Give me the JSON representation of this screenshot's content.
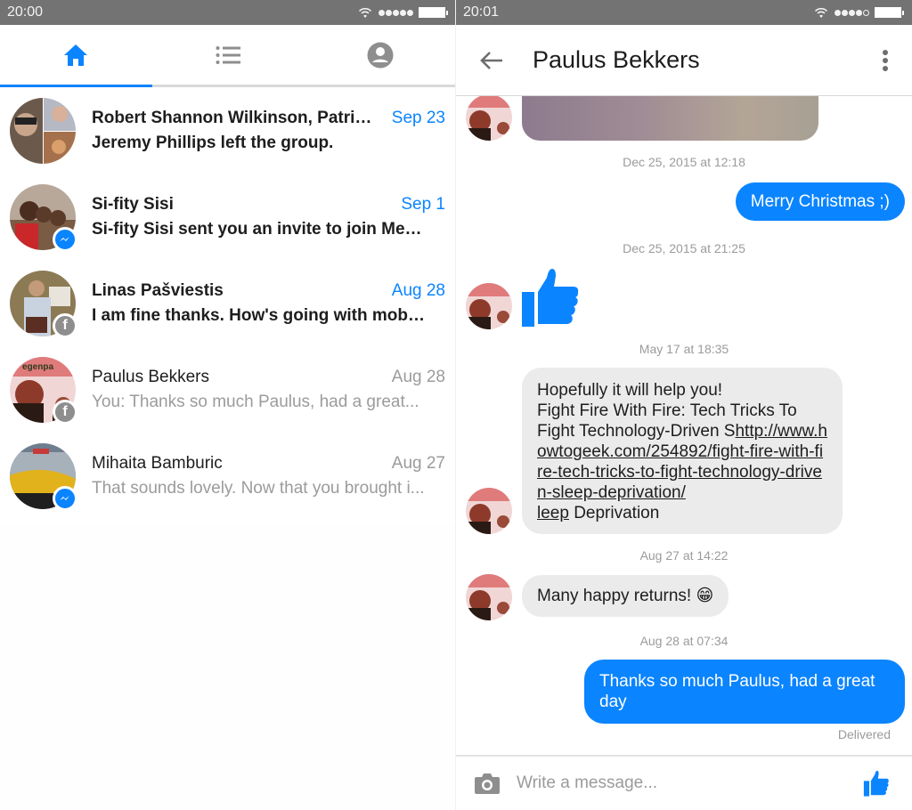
{
  "colors": {
    "accent": "#0a84ff",
    "status_bar": "#737373",
    "incoming_bubble": "#ebebeb",
    "muted_text": "#9b9b9b"
  },
  "left_screen": {
    "status_bar": {
      "time": "20:00",
      "signal_bars_filled": 5,
      "signal_bars_total": 5
    },
    "tabs": [
      {
        "name": "home",
        "icon": "home-icon",
        "active": true
      },
      {
        "name": "list",
        "icon": "list-icon",
        "active": false
      },
      {
        "name": "profile",
        "icon": "person-circle-icon",
        "active": false
      }
    ],
    "conversations": [
      {
        "name": "Robert Shannon Wilkinson, Patrick...",
        "date": "Sep 23",
        "snippet": "Jeremy Phillips left the group.",
        "unread": true,
        "badge": "none",
        "avatar": "group-photo"
      },
      {
        "name": "Si-fity Sisi",
        "date": "Sep 1",
        "snippet": "Si-fity Sisi sent you an invite to join Mess...",
        "unread": true,
        "badge": "messenger",
        "avatar": "group-selfie"
      },
      {
        "name": "Linas Pašviestis",
        "date": "Aug 28",
        "snippet": "I am fine thanks. How's going with mobile...",
        "unread": true,
        "badge": "facebook",
        "avatar": "man-standing"
      },
      {
        "name": "Paulus Bekkers",
        "date": "Aug 28",
        "snippet": "You: Thanks so much Paulus, had a great...",
        "unread": false,
        "badge": "facebook",
        "avatar": "two-men-poster"
      },
      {
        "name": "Mihaita Bamburic",
        "date": "Aug 27",
        "snippet": "That sounds lovely. Now that you brought i...",
        "unread": false,
        "badge": "messenger",
        "avatar": "yellow-helmet"
      }
    ]
  },
  "right_screen": {
    "status_bar": {
      "time": "20:01",
      "signal_bars_filled": 4,
      "signal_bars_total": 5
    },
    "header": {
      "title": "Paulus Bekkers"
    },
    "messages": [
      {
        "type": "image",
        "direction": "in"
      },
      {
        "type": "timestamp",
        "text": "Dec 25, 2015 at 12:18"
      },
      {
        "type": "text",
        "direction": "out",
        "text": "Merry Christmas ;)"
      },
      {
        "type": "timestamp",
        "text": "Dec 25, 2015 at 21:25"
      },
      {
        "type": "like",
        "direction": "in"
      },
      {
        "type": "timestamp",
        "text": "May 17 at 18:35"
      },
      {
        "type": "text",
        "direction": "in",
        "line1": "Hopefully it will help you!",
        "line2": "Fight Fire With Fire: Tech Tricks To Fight Technology-Driven S",
        "link": "http://www.howtogeek.com/254892/fight-fire-with-fire-tech-tricks-to-fight-technology-driven-sleep-deprivation/",
        "link_tail": "leep",
        "after_link": " Deprivation"
      },
      {
        "type": "timestamp",
        "text": "Aug 27 at 14:22"
      },
      {
        "type": "text",
        "direction": "in",
        "text": "Many happy returns! ",
        "emoji": "😁"
      },
      {
        "type": "timestamp",
        "text": "Aug 28 at 07:34"
      },
      {
        "type": "text",
        "direction": "out",
        "text": "Thanks so much Paulus, had a great day"
      }
    ],
    "delivery_status": "Delivered",
    "composer": {
      "placeholder": "Write a message..."
    }
  }
}
